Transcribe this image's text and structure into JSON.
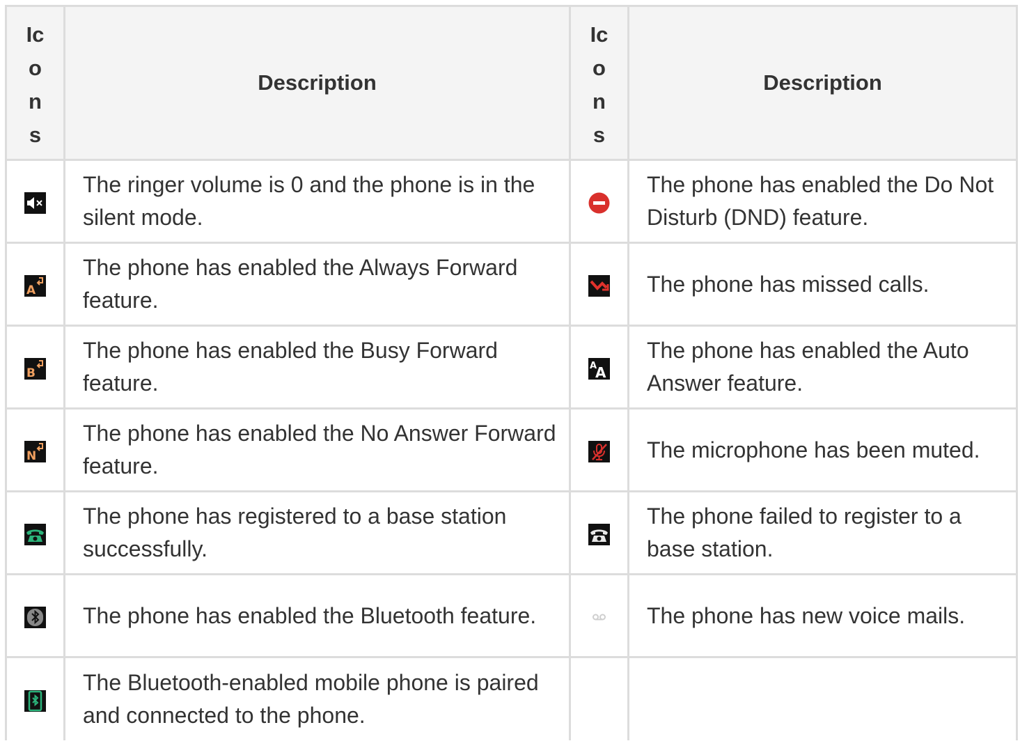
{
  "table": {
    "headers": {
      "icons_chars": [
        "Ic",
        "o",
        "n",
        "s"
      ],
      "description": "Description"
    },
    "rows": [
      {
        "left": {
          "icon": "silent-mode-icon",
          "text": "The ringer volume is 0 and the phone is in the silent mode."
        },
        "right": {
          "icon": "dnd-icon",
          "text": "The phone has enabled the Do Not Disturb (DND) feature."
        }
      },
      {
        "left": {
          "icon": "always-forward-icon",
          "text": "The phone has enabled the Always Forward feature."
        },
        "right": {
          "icon": "missed-call-icon",
          "text": "The phone has missed calls."
        }
      },
      {
        "left": {
          "icon": "busy-forward-icon",
          "text": "The phone has enabled the Busy Forward feature."
        },
        "right": {
          "icon": "auto-answer-icon",
          "text": "The phone has enabled the Auto Answer feature."
        }
      },
      {
        "left": {
          "icon": "no-answer-forward-icon",
          "text": "The phone has enabled the No Answer Forward feature."
        },
        "right": {
          "icon": "mic-muted-icon",
          "text": "The microphone has been muted."
        }
      },
      {
        "left": {
          "icon": "registered-icon",
          "text": "The phone has registered to a base station successfully."
        },
        "right": {
          "icon": "register-failed-icon",
          "text": "The phone failed to register to a base station."
        }
      },
      {
        "left": {
          "icon": "bluetooth-icon",
          "text": "The phone has enabled the Bluetooth feature."
        },
        "right": {
          "icon": "voicemail-icon",
          "text": "The phone has new voice mails."
        }
      },
      {
        "left": {
          "icon": "bluetooth-mobile-paired-icon",
          "text": "The Bluetooth-enabled mobile phone is paired and connected to the phone."
        },
        "right": {
          "icon": "",
          "text": ""
        }
      }
    ]
  },
  "colors": {
    "border": "#dcdcdc",
    "header_bg": "#f4f4f4",
    "forward_letter": "#f0a060",
    "dnd_red": "#d9302c",
    "registered_green": "#2bb37a"
  }
}
